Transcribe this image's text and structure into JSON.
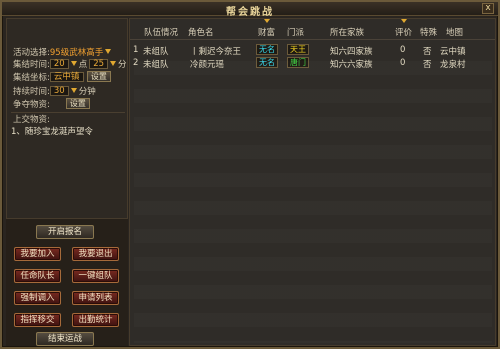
{
  "window": {
    "title": "帮会跳战",
    "close_label": "x"
  },
  "left": {
    "activity_label": "活动选择:",
    "activity_value": "95级武林高手",
    "time_label": "集结时间:",
    "time_hour": "20",
    "time_sep": "点",
    "time_min": "25",
    "time_unit": "分",
    "coord_label": "集结坐标:",
    "coord_value": "云中镇",
    "set_label": "设置",
    "duration_label": "持续时间:",
    "duration_value": "30",
    "duration_unit": "分钟",
    "contest_label": "争夺物资:",
    "contest_set": "设置",
    "submit_label": "上交物资:",
    "submit_item": "1、随珍宝龙涎声望令"
  },
  "buttons": {
    "open_signup": "开启报名",
    "join": "我要加入",
    "leave": "我要退出",
    "appoint_leader": "任命队长",
    "one_key_team": "一键组队",
    "force_join": "强制调入",
    "apply_list": "申请列表",
    "command_move": "指挥移交",
    "recruit_stats": "出勤统计",
    "end_battle": "结束运战"
  },
  "table": {
    "headers": [
      "队伍情况",
      "角色名",
      "财富",
      "门派",
      "所在家族",
      "评价",
      "特殊",
      "地图"
    ],
    "rows": [
      {
        "num": "1",
        "team": "未组队",
        "name": "丨剩迟今奈王",
        "wealth": "无名",
        "sect": "天王",
        "family": "知六四家族",
        "rating": "0",
        "special": "否",
        "map": "云中镇"
      },
      {
        "num": "2",
        "team": "未组队",
        "name": "冷颜元瑶",
        "wealth": "无名",
        "sect": "唐门",
        "family": "知六六家族",
        "rating": "0",
        "special": "否",
        "map": "龙泉村"
      }
    ]
  }
}
